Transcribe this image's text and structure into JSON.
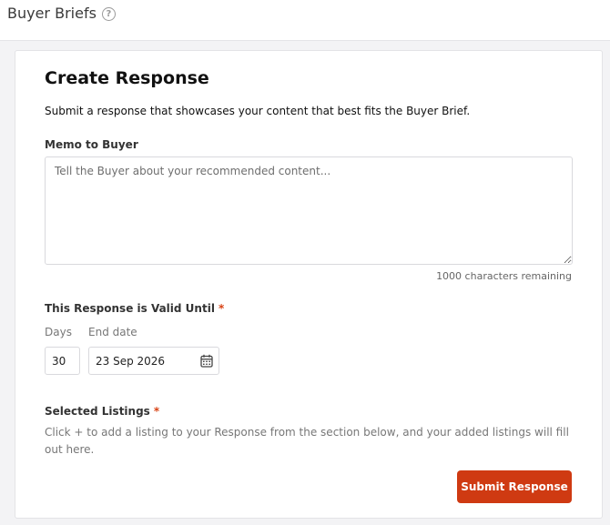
{
  "header": {
    "title": "Buyer Briefs",
    "help_icon": "question-circle-icon",
    "help_glyph": "?"
  },
  "form": {
    "title": "Create Response",
    "intro": "Submit a response that showcases your content that best fits the Buyer Brief.",
    "memo": {
      "label": "Memo to Buyer",
      "placeholder": "Tell the Buyer about your recommended content...",
      "value": "",
      "counter": "1000 characters remaining"
    },
    "validity": {
      "label": "This Response is Valid Until",
      "required_mark": "*",
      "days_label": "Days",
      "days_value": "30",
      "end_date_label": "End date",
      "end_date_value": "23 Sep 2026",
      "calendar_icon": "calendar-icon"
    },
    "listings": {
      "label": "Selected Listings",
      "required_mark": "*",
      "hint": "Click + to add a listing to your Response from the section below, and your added listings will fill out here."
    },
    "submit_label": "Submit Response"
  },
  "colors": {
    "accent": "#cf3a12",
    "required": "#d84315",
    "background": "#f3f3f5"
  }
}
